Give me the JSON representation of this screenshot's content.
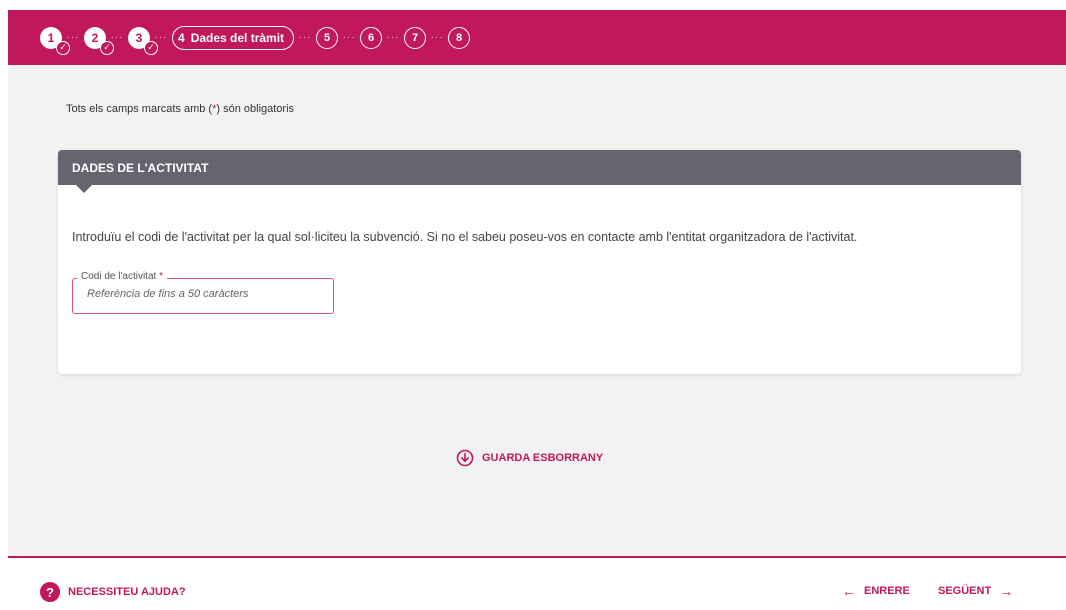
{
  "stepper": {
    "done_steps": [
      {
        "number": "1"
      },
      {
        "number": "2"
      },
      {
        "number": "3"
      }
    ],
    "check_glyph": "✓",
    "current_step": {
      "number": "4",
      "label": "Dades del tràmit"
    },
    "future_steps": [
      "5",
      "6",
      "7",
      "8"
    ],
    "separator": "···"
  },
  "required_note": {
    "before": "Tots els camps marcats amb (",
    "asterisk": "*",
    "after": ") són obligatoris"
  },
  "section": {
    "title": "DADES DE L'ACTIVITAT",
    "intro": "Introduïu el codi de l'activitat per la qual sol·liciteu la subvenció. Si no el sabeu poseu-vos en contacte amb l'entitat organitzadora de l'activitat.",
    "field": {
      "label": "Codi de l'activitat",
      "required_mark": "*",
      "placeholder": "Referència de fins a 50 caràcters",
      "value": ""
    }
  },
  "actions": {
    "save_draft": "GUARDA ESBORRANY"
  },
  "footer": {
    "help_label": "NECESSITEU AJUDA?",
    "help_icon": "?",
    "back_label": "ENRERE",
    "back_arrow": "←",
    "next_label": "SEGÜENT",
    "next_arrow": "→"
  },
  "colors": {
    "brand": "#c0185b",
    "section_header": "#656570",
    "field_border": "#d8566f",
    "page_bg": "#f2f2f2"
  }
}
